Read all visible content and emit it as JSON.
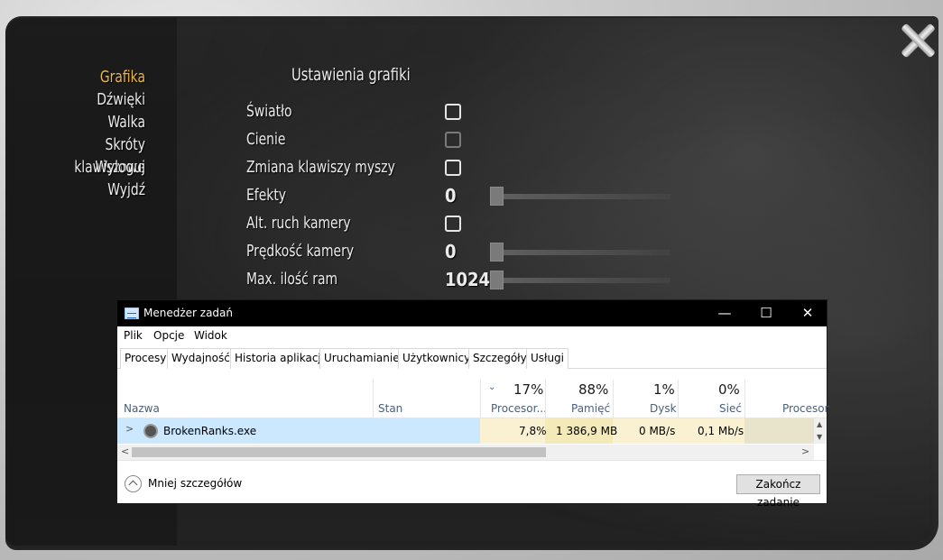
{
  "menu": {
    "items": [
      "Grafika",
      "Dźwięki",
      "Walka",
      "Skróty klawiszowe",
      "Wyloguj",
      "Wyjdź"
    ],
    "active_index": 0,
    "active_color": "#e9b64a"
  },
  "settings": {
    "title": "Ustawienia grafiki",
    "rows": [
      {
        "label": "Światło",
        "type": "checkbox",
        "checked": false
      },
      {
        "label": "Cienie",
        "type": "checkbox",
        "checked": false,
        "disabled": true
      },
      {
        "label": "Zmiana klawiszy myszy",
        "type": "checkbox",
        "checked": false
      },
      {
        "label": "Efekty",
        "type": "slider",
        "value": "0",
        "level": 0
      },
      {
        "label": "Alt. ruch kamery",
        "type": "checkbox",
        "checked": false
      },
      {
        "label": "Prędkość kamery",
        "type": "slider",
        "value": "0",
        "level": 0
      },
      {
        "label": "Max. ilość ram",
        "type": "slider",
        "value": "1024",
        "level": 0
      }
    ]
  },
  "close_icon": "close-x-icon",
  "task_manager": {
    "title": "Menedżer zadań",
    "window_buttons": {
      "minimize": "—",
      "maximize": "☐",
      "close": "✕"
    },
    "menu": [
      "Plik",
      "Opcje",
      "Widok"
    ],
    "tabs": [
      "Procesy",
      "Wydajność",
      "Historia aplikacji",
      "Uruchamianie",
      "Użytkownicy",
      "Szczegóły",
      "Usługi"
    ],
    "active_tab": 0,
    "columns": {
      "name": "Nazwa",
      "status": "Stan",
      "cpu": {
        "label": "Procesor...",
        "pct": "17%"
      },
      "memory": {
        "label": "Pamięć",
        "pct": "88%"
      },
      "disk": {
        "label": "Dysk",
        "pct": "1%"
      },
      "network": {
        "label": "Sieć",
        "pct": "0%"
      },
      "gpu": {
        "label": "Procesor"
      }
    },
    "process": {
      "name": "BrokenRanks.exe",
      "cpu": "7,8%",
      "memory": "1 386,9 MB",
      "disk": "0 MB/s",
      "network": "0,1 Mb/s"
    },
    "footer": {
      "less_details": "Mniej szczegółów",
      "end_task": "Zakończ zadanie"
    }
  }
}
